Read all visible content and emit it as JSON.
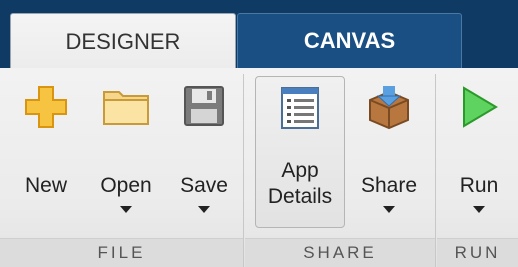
{
  "tabs": {
    "designer": "DESIGNER",
    "canvas": "CANVAS"
  },
  "sections": {
    "file": "FILE",
    "share": "SHARE",
    "run": "RUN"
  },
  "buttons": {
    "new": "New",
    "open": "Open",
    "save": "Save",
    "app_details_line1": "App",
    "app_details_line2": "Details",
    "share": "Share",
    "run": "Run"
  },
  "icons": {
    "new": "plus-icon",
    "open": "folder-icon",
    "save": "floppy-disk-icon",
    "app_details": "app-details-icon",
    "share": "package-share-icon",
    "run": "play-icon"
  },
  "colors": {
    "tab_bar": "#0f3a63",
    "active_tab": "#ececec",
    "inactive_tab": "#1a4f83",
    "new_icon": "#f5b623",
    "run_icon": "#3fbf3f"
  }
}
